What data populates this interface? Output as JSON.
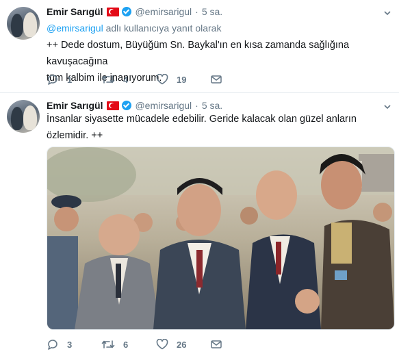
{
  "tweets": [
    {
      "author": {
        "name": "Emir Sarıgül",
        "handle": "@emirsarigul",
        "verified": true,
        "flag": "turkey-flag"
      },
      "dot": "·",
      "time": "5 sa.",
      "reply_to": {
        "mention": "@emirsarigul",
        "suffix": " adlı kullanıcıya yanıt olarak"
      },
      "text_lines": [
        "++ Dede dostum, Büyüğüm Sn. Baykal'ın en kısa zamanda sağlığına kavuşacağına",
        "tüm kalbim ile inanıyorum."
      ],
      "stats": {
        "replies": "1",
        "retweets": "4",
        "likes": "19"
      }
    },
    {
      "author": {
        "name": "Emir Sarıgül",
        "handle": "@emirsarigul",
        "verified": true,
        "flag": "turkey-flag"
      },
      "dot": "·",
      "time": "5 sa.",
      "text_lines": [
        "İnsanlar siyasette mücadele edebilir. Geride kalacak olan güzel anların",
        "özlemidir.  ++"
      ],
      "stats": {
        "replies": "3",
        "retweets": "6",
        "likes": "26"
      }
    }
  ],
  "colors": {
    "accent": "#1da1f2",
    "muted": "#657786",
    "text": "#14171a",
    "divider": "#e6ecf0"
  },
  "icons": [
    "caret-down-icon",
    "reply-icon",
    "retweet-icon",
    "like-icon",
    "message-icon",
    "verified-badge-icon"
  ]
}
